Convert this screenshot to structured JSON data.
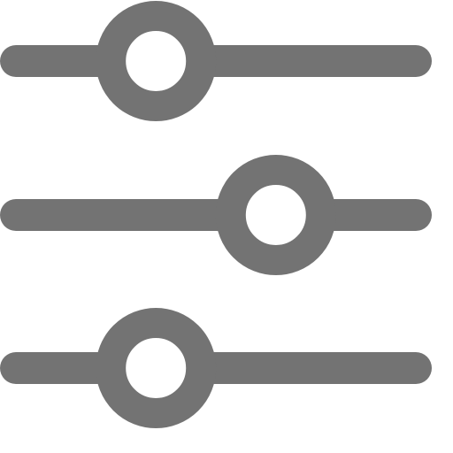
{
  "icon": {
    "name": "sliders-icon",
    "color": "#737373"
  },
  "sliders": [
    {
      "name": "slider-1",
      "level": 0.35
    },
    {
      "name": "slider-2",
      "level": 0.65
    },
    {
      "name": "slider-3",
      "level": 0.35
    }
  ]
}
